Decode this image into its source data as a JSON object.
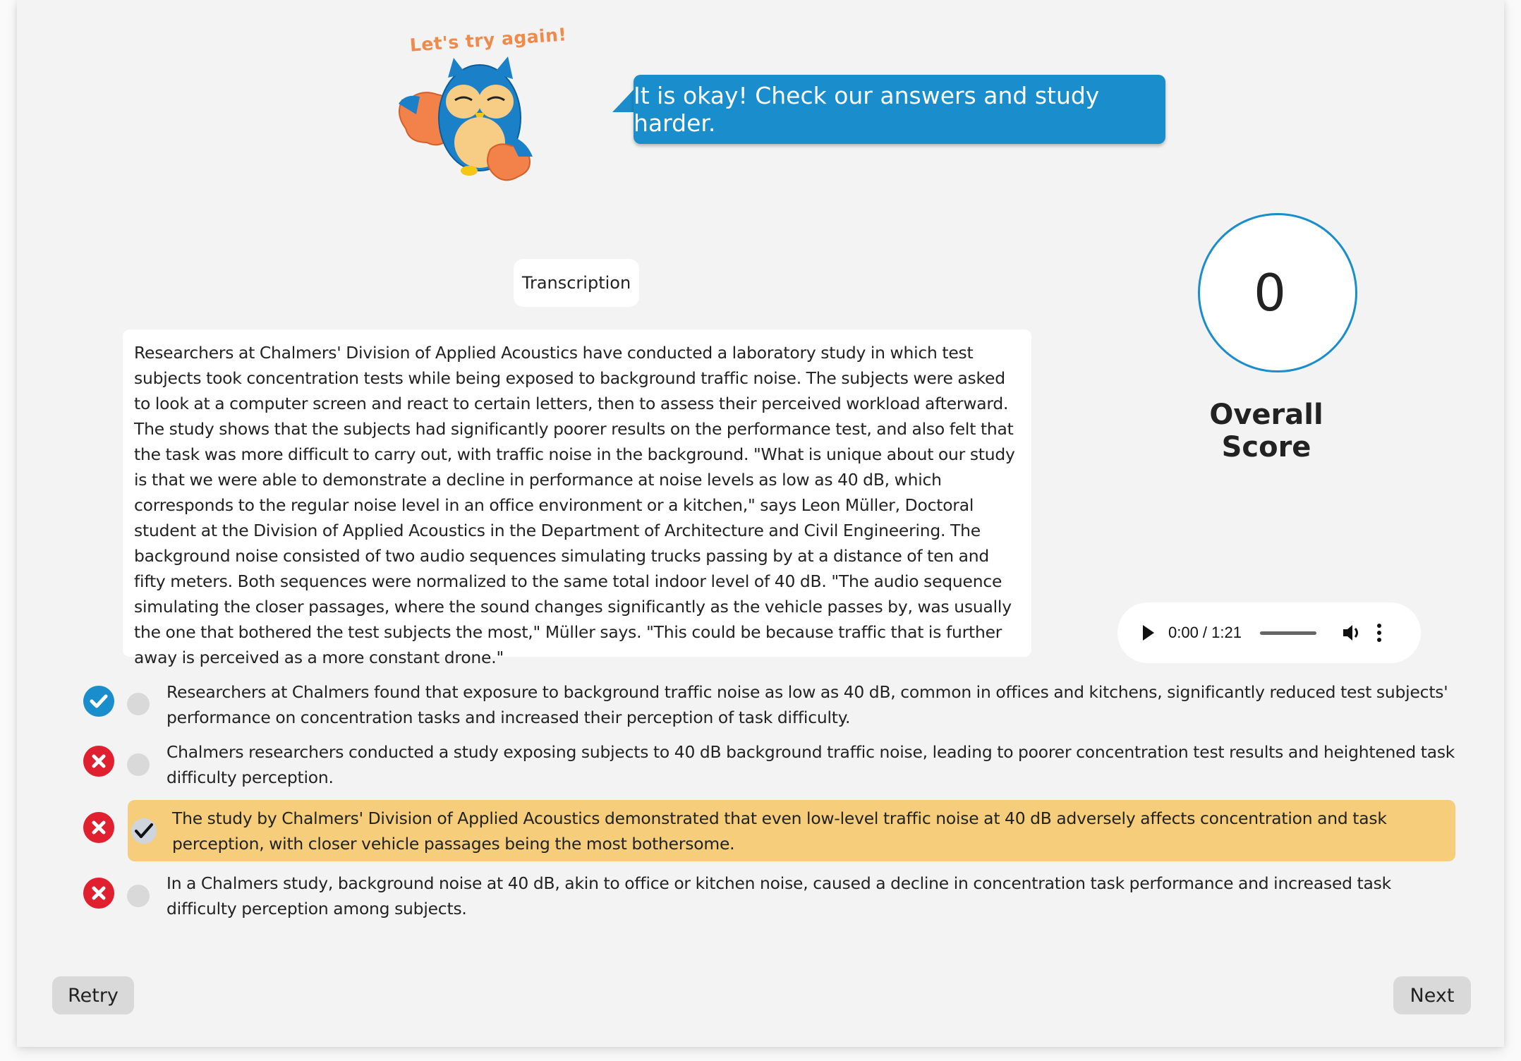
{
  "mascot": {
    "caption": "Let's try again!",
    "icon": "owl-mascot-icon"
  },
  "feedback": {
    "message": "It is okay! Check our answers and study harder."
  },
  "transcription": {
    "label": "Transcription",
    "text": "Researchers at Chalmers' Division of Applied Acoustics have conducted a laboratory study in which test subjects took concentration tests while being exposed to background traffic noise. The subjects were asked to look at a computer screen and react to certain letters, then to assess their perceived workload afterward. The study shows that the subjects had significantly poorer results on the performance test, and also felt that the task was more difficult to carry out, with traffic noise in the background. \"What is unique about our study is that we were able to demonstrate a decline in performance at noise levels as low as 40 dB, which corresponds to the regular noise level in an office environment or a kitchen,\" says Leon Müller, Doctoral student at the Division of Applied Acoustics in the Department of Architecture and Civil Engineering. The background noise consisted of two audio sequences simulating trucks passing by at a distance of ten and fifty meters. Both sequences were normalized to the same total indoor level of 40 dB. \"The audio sequence simulating the closer passages, where the sound changes significantly as the vehicle passes by, was usually the one that bothered the test subjects the most,\" Müller says. \"This could be because traffic that is further away is perceived as a more constant drone.\""
  },
  "score": {
    "value": "0",
    "label": "Overall Score"
  },
  "audio": {
    "current_time": "0:00",
    "separator": " / ",
    "duration": "1:21",
    "time_display": "0:00 / 1:21",
    "progress_fraction": 0
  },
  "options": [
    {
      "text": "Researchers at Chalmers found that exposure to background traffic noise as low as 40 dB, common in offices and kitchens, significantly reduced test subjects' performance on concentration tasks and increased their perception of task difficulty.",
      "status": "correct",
      "selected": false
    },
    {
      "text": "Chalmers researchers conducted a study exposing subjects to 40 dB background traffic noise, leading to poorer concentration test results and heightened task difficulty perception.",
      "status": "wrong",
      "selected": false
    },
    {
      "text": "The study by Chalmers' Division of Applied Acoustics demonstrated that even low-level traffic noise at 40 dB adversely affects concentration and task perception, with closer vehicle passages being the most bothersome.",
      "status": "wrong",
      "selected": true
    },
    {
      "text": "In a Chalmers study, background noise at 40 dB, akin to office or kitchen noise, caused a decline in concentration task performance and increased task difficulty perception among subjects.",
      "status": "wrong",
      "selected": false
    }
  ],
  "buttons": {
    "retry": "Retry",
    "next": "Next"
  },
  "colors": {
    "accent_blue": "#1a8dcc",
    "wrong_red": "#e0202f",
    "selected_highlight": "#f5cd7b",
    "card_background": "#f3f3f3",
    "mascot_caption": "#f08a4b"
  }
}
